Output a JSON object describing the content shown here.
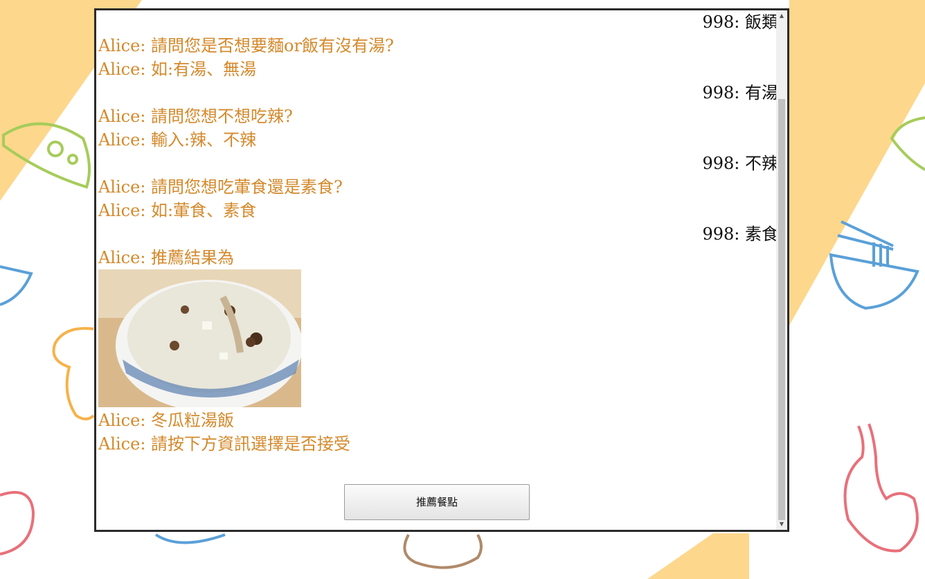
{
  "chat": {
    "messages": [
      {
        "role": "user",
        "text": "998: 飯類"
      },
      {
        "role": "bot",
        "text": "Alice: 請問您是否想要麵or飯有沒有湯?"
      },
      {
        "role": "bot",
        "text": "Alice: 如:有湯、無湯"
      },
      {
        "role": "user",
        "text": "998: 有湯"
      },
      {
        "role": "bot",
        "text": "Alice: 請問您想不想吃辣?"
      },
      {
        "role": "bot",
        "text": "Alice: 輸入:辣、不辣"
      },
      {
        "role": "user",
        "text": "998: 不辣"
      },
      {
        "role": "bot",
        "text": "Alice: 請問您想吃葷食還是素食?"
      },
      {
        "role": "bot",
        "text": "Alice: 如:葷食、素食"
      },
      {
        "role": "user",
        "text": "998: 素食"
      },
      {
        "role": "bot",
        "text": "Alice: 推薦結果為"
      },
      {
        "role": "bot",
        "text": "Alice: 冬瓜粒湯飯"
      },
      {
        "role": "bot",
        "text": "Alice: 請按下方資訊選擇是否接受"
      }
    ]
  },
  "button": {
    "recommend_label": "推薦餐點"
  },
  "scrollbar": {
    "up_glyph": "▲",
    "down_glyph": "▼"
  },
  "colors": {
    "bot_text": "#d4892b",
    "user_text": "#111111",
    "bg_yellow": "#fdd78c"
  }
}
